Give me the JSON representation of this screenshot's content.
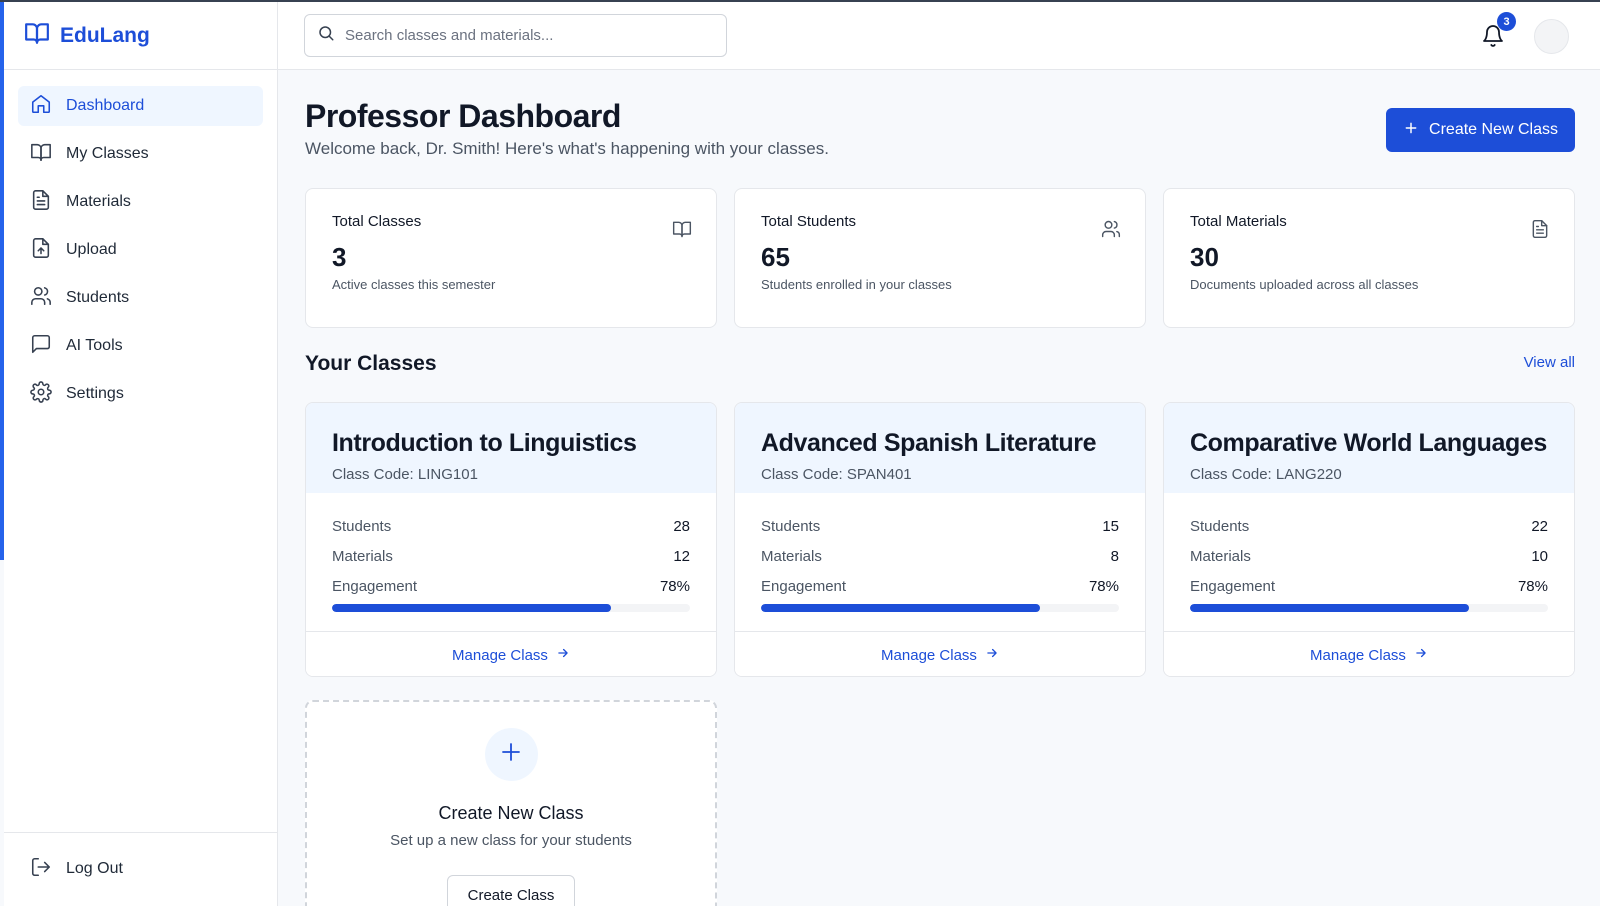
{
  "brand": {
    "name": "EduLang",
    "icon": "book-open-icon"
  },
  "sidebar": {
    "items": [
      {
        "label": "Dashboard",
        "icon": "home-icon",
        "active": true
      },
      {
        "label": "My Classes",
        "icon": "book-open-icon"
      },
      {
        "label": "Materials",
        "icon": "file-text-icon"
      },
      {
        "label": "Upload",
        "icon": "file-upload-icon"
      },
      {
        "label": "Students",
        "icon": "users-icon"
      },
      {
        "label": "AI Tools",
        "icon": "message-square-icon"
      },
      {
        "label": "Settings",
        "icon": "gear-icon"
      }
    ],
    "logout_label": "Log Out"
  },
  "topbar": {
    "search_placeholder": "Search classes and materials...",
    "notification_count": "3"
  },
  "header": {
    "title": "Professor Dashboard",
    "subtitle": "Welcome back, Dr. Smith! Here's what's happening with your classes.",
    "create_button": "Create New Class"
  },
  "stats": [
    {
      "label": "Total Classes",
      "value": "3",
      "desc": "Active classes this semester",
      "icon": "book-open-icon"
    },
    {
      "label": "Total Students",
      "value": "65",
      "desc": "Students enrolled in your classes",
      "icon": "users-icon"
    },
    {
      "label": "Total Materials",
      "value": "30",
      "desc": "Documents uploaded across all classes",
      "icon": "file-text-icon"
    }
  ],
  "classes_section": {
    "title": "Your Classes",
    "view_all": "View all",
    "row_labels": {
      "students": "Students",
      "materials": "Materials",
      "engagement": "Engagement"
    },
    "manage_label": "Manage Class",
    "items": [
      {
        "title": "Introduction to Linguistics",
        "code": "Class Code: LING101",
        "students": "28",
        "materials": "12",
        "engagement": "78%",
        "engagement_fraction": 0.78
      },
      {
        "title": "Advanced Spanish Literature",
        "code": "Class Code: SPAN401",
        "students": "15",
        "materials": "8",
        "engagement": "78%",
        "engagement_fraction": 0.78
      },
      {
        "title": "Comparative World Languages",
        "code": "Class Code: LANG220",
        "students": "22",
        "materials": "10",
        "engagement": "78%",
        "engagement_fraction": 0.78
      }
    ]
  },
  "create_card": {
    "title": "Create New Class",
    "subtitle": "Set up a new class for your students",
    "button": "Create Class"
  },
  "colors": {
    "accent": "#1d4ed8",
    "accent_light": "#eff6ff",
    "background": "#f7f9fc"
  }
}
